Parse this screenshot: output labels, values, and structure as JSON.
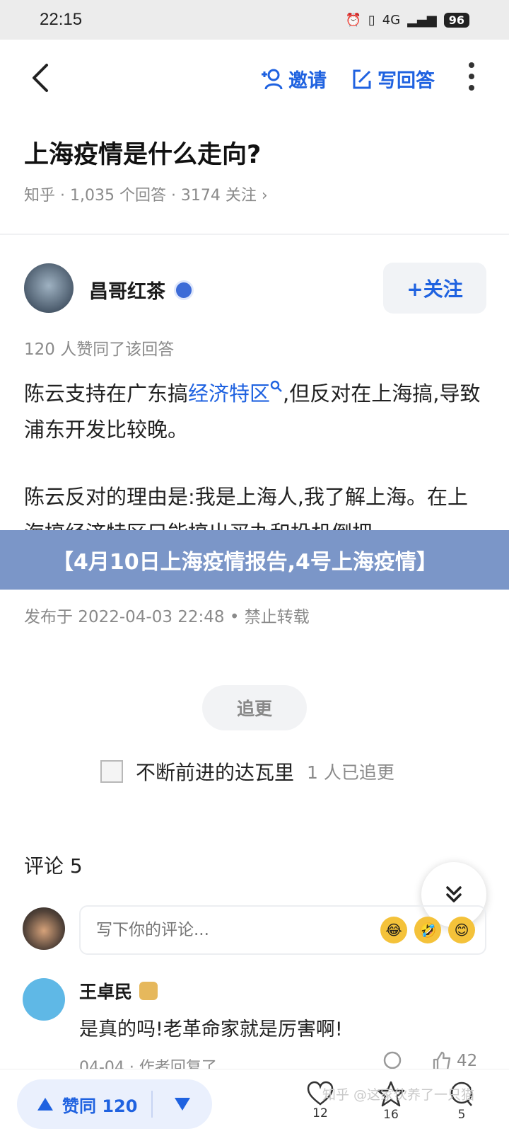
{
  "status_bar": {
    "time": "22:15",
    "network": "4G",
    "battery": "96"
  },
  "nav": {
    "invite_label": "邀请",
    "write_label": "写回答"
  },
  "question": {
    "title": "上海疫情是什么走向?",
    "meta": "知乎 · 1,035 个回答 · 3174 关注 ›"
  },
  "answer": {
    "author": "昌哥红茶",
    "follow_label": "+关注",
    "votes_text": "120 人赞同了该回答",
    "p1_before": "陈云支持在广东搞",
    "p1_link": "经济特区",
    "p1_after": ",但反对在上海搞,导致浦东开发比较晚。",
    "p2": "陈云反对的理由是:我是上海人,我了解上海。在上海搞经济特区只能搞出买办和投机倒把。",
    "published": "发布于 2022-04-03 22:48 • 禁止转载"
  },
  "banner": {
    "text": "【4月10日上海疫情报告,4号上海疫情】"
  },
  "update": {
    "button_label": "追更",
    "follower_name": "不断前进的达瓦里",
    "follower_count": "1 人已追更"
  },
  "comments": {
    "title": "评论 5",
    "input_placeholder": "写下你的评论...",
    "items": [
      {
        "author": "王卓民",
        "text": "是真的吗!老革命家就是厉害啊!",
        "meta": "04-04 · 作者回复了",
        "likes": "42"
      }
    ]
  },
  "bottom_bar": {
    "upvote_label": "赞同 120",
    "comment_count": "12",
    "star_count": "16",
    "msg_count": "5"
  },
  "watermark": "知乎 @这家伙养了一只猫",
  "colors": {
    "accent": "#1f62e0",
    "banner_bg": "#7b96c8"
  }
}
